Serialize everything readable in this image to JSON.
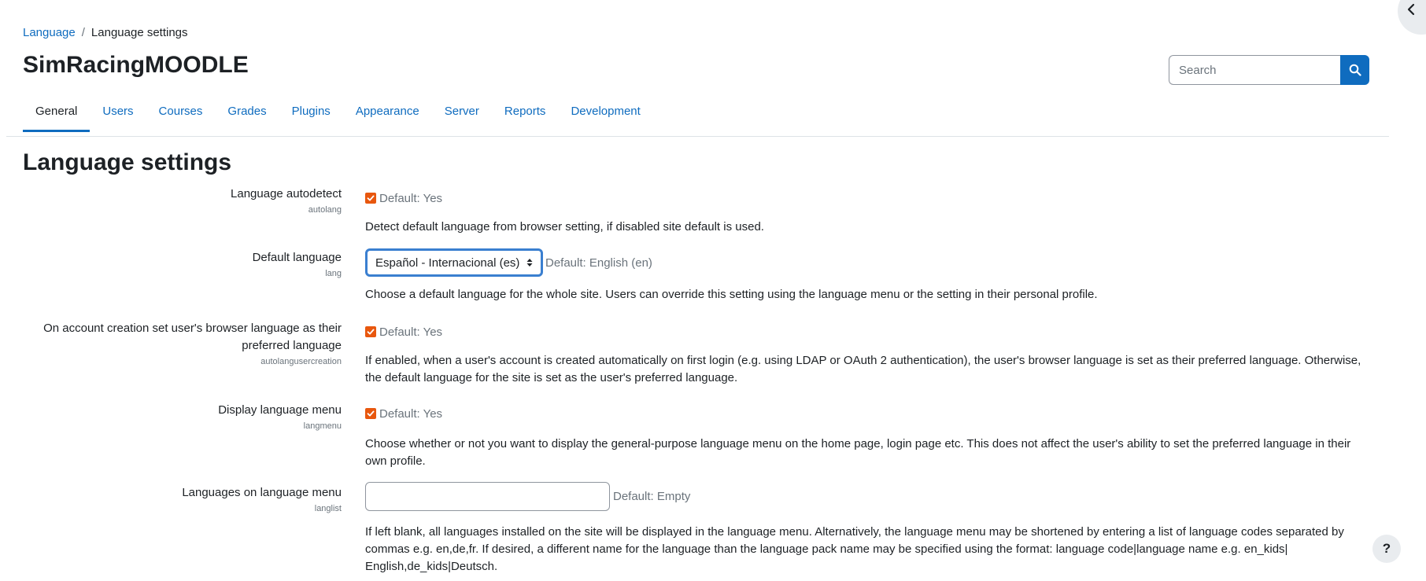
{
  "breadcrumb": {
    "parent": "Language",
    "separator": "/",
    "current": "Language settings"
  },
  "site_title": "SimRacingMOODLE",
  "search": {
    "placeholder": "Search"
  },
  "tabs": [
    {
      "label": "General",
      "active": true
    },
    {
      "label": "Users"
    },
    {
      "label": "Courses"
    },
    {
      "label": "Grades"
    },
    {
      "label": "Plugins"
    },
    {
      "label": "Appearance"
    },
    {
      "label": "Server"
    },
    {
      "label": "Reports"
    },
    {
      "label": "Development"
    }
  ],
  "page_heading": "Language settings",
  "settings": {
    "autolang": {
      "label": "Language autodetect",
      "key": "autolang",
      "checked": true,
      "default": "Default: Yes",
      "description": "Detect default language from browser setting, if disabled site default is used."
    },
    "lang": {
      "label": "Default language",
      "key": "lang",
      "selected": "Español - Internacional (es)",
      "default": "Default: English (en)",
      "description": "Choose a default language for the whole site. Users can override this setting using the language menu or the setting in their personal profile."
    },
    "autolangusercreation": {
      "label": "On account creation set user's browser language as their preferred language",
      "key": "autolangusercreation",
      "checked": true,
      "default": "Default: Yes",
      "description": "If enabled, when a user's account is created automatically on first login (e.g. using LDAP or OAuth 2 authentication), the user's browser language is set as their preferred language. Otherwise, the default language for the site is set as the user's preferred language."
    },
    "langmenu": {
      "label": "Display language menu",
      "key": "langmenu",
      "checked": true,
      "default": "Default: Yes",
      "description": "Choose whether or not you want to display the general-purpose language menu on the home page, login page etc. This does not affect the user's ability to set the preferred language in their own profile."
    },
    "langlist": {
      "label": "Languages on language menu",
      "key": "langlist",
      "value": "",
      "default": "Default: Empty",
      "description_lines": [
        "If left blank, all languages installed on the site will be displayed in the language menu. Alternatively, the language menu may be shortened by entering a list of language codes separated by",
        "commas e.g. en,de,fr. If desired, a different name for the language than the language pack name may be specified using the format: language code|language name e.g. en_kids|",
        "English,de_kids|Deutsch."
      ]
    }
  },
  "help_button": "?",
  "colors": {
    "link": "#0f6cbf",
    "checkbox": "#e8570e",
    "muted": "#6a737b",
    "text": "#1d2125"
  },
  "icons": {
    "search": "search-icon",
    "drawer": "chevron-left-icon",
    "select": "sort-arrows-icon",
    "check": "check-icon"
  }
}
